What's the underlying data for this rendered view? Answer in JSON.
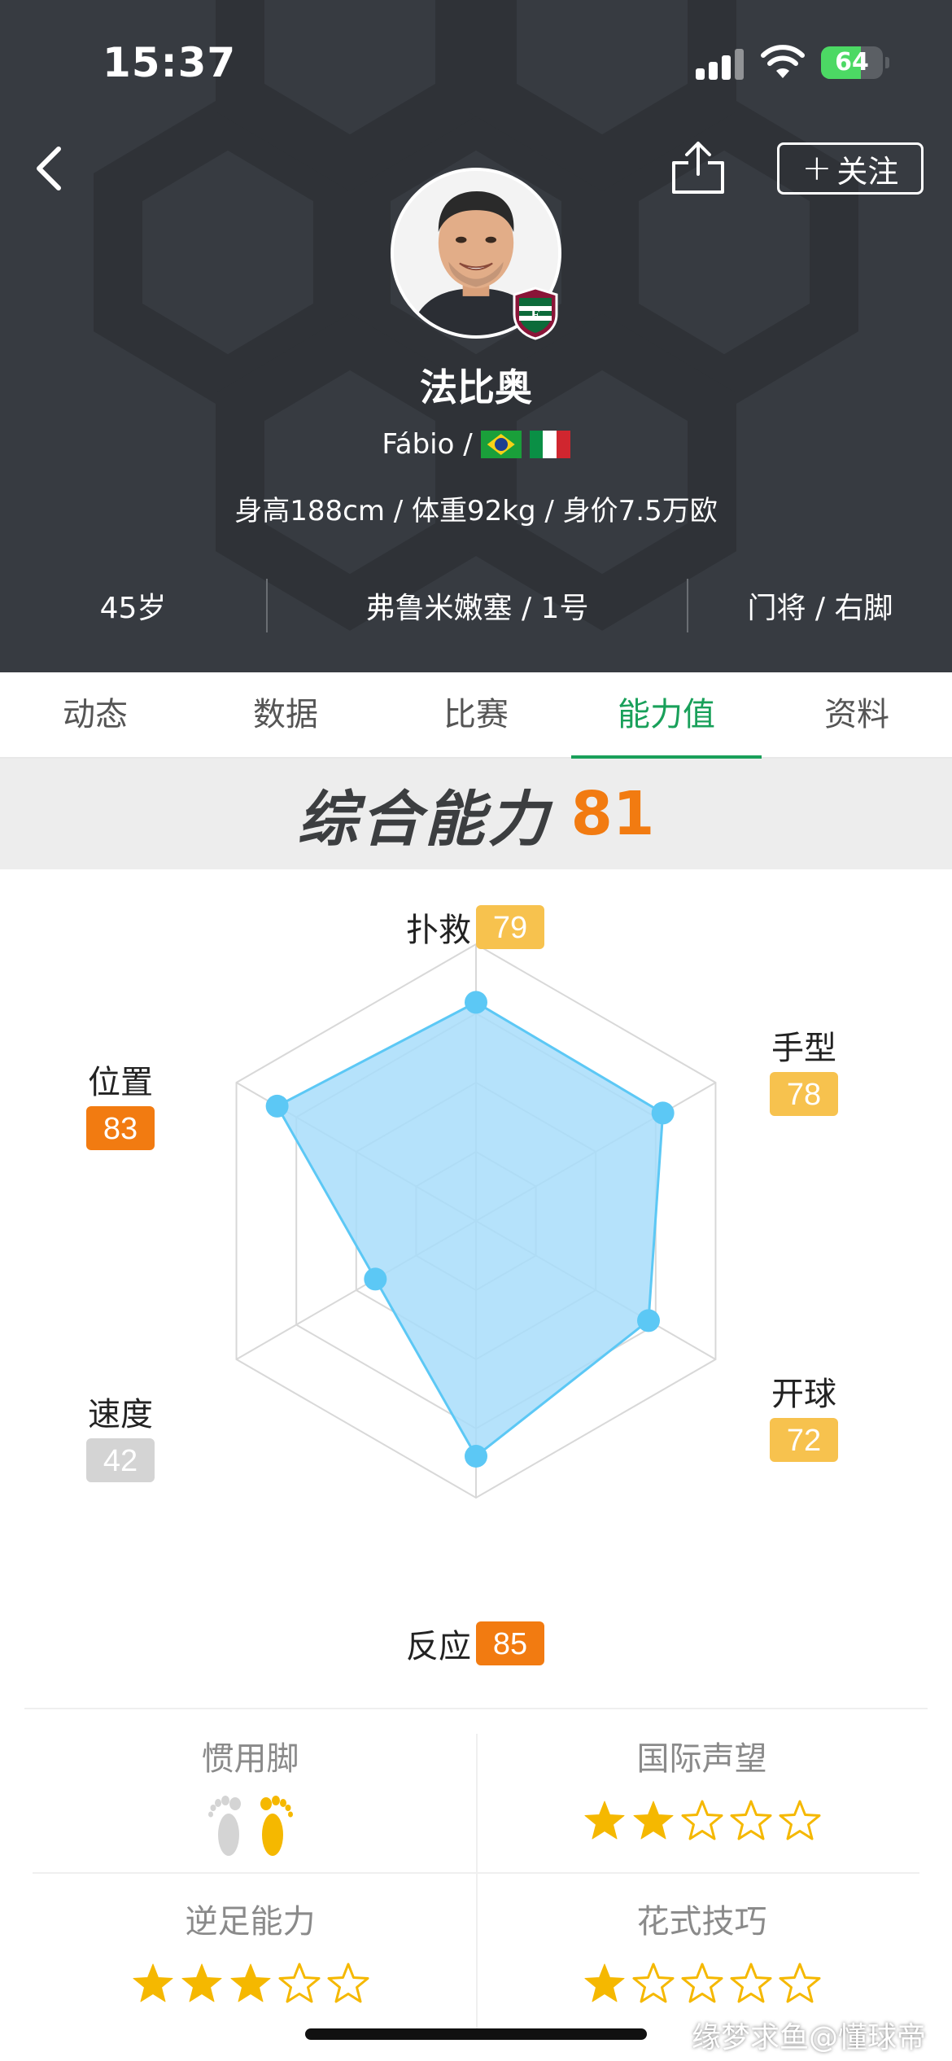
{
  "status": {
    "time": "15:37",
    "battery": "64",
    "battery_level": 0.64
  },
  "header": {
    "follow_label": "关注",
    "player_name": "法比奥",
    "name_latin": "Fábio /",
    "info": "身高188cm / 体重92kg / 身价7.5万欧",
    "stats": [
      "45岁",
      "弗鲁米嫩塞 / 1号",
      "门将 / 右脚"
    ],
    "flags": [
      "brazil-flag",
      "italy-flag"
    ]
  },
  "tabs": [
    {
      "label": "动态",
      "active": false
    },
    {
      "label": "数据",
      "active": false
    },
    {
      "label": "比赛",
      "active": false
    },
    {
      "label": "能力值",
      "active": true
    },
    {
      "label": "资料",
      "active": false
    }
  ],
  "overall": {
    "label": "综合能力",
    "value": "81"
  },
  "chart_data": {
    "type": "radar",
    "max": 100,
    "axes": [
      {
        "label": "扑救",
        "value": 79
      },
      {
        "label": "手型",
        "value": 78
      },
      {
        "label": "开球",
        "value": 72
      },
      {
        "label": "反应",
        "value": 85
      },
      {
        "label": "速度",
        "value": 42
      },
      {
        "label": "位置",
        "value": 83
      }
    ]
  },
  "attributes": {
    "foot": {
      "label": "惯用脚",
      "preferred": "right"
    },
    "reputation": {
      "label": "国际声望",
      "stars": 2,
      "max": 5
    },
    "weak_foot": {
      "label": "逆足能力",
      "stars": 3,
      "max": 5
    },
    "skill_moves": {
      "label": "花式技巧",
      "stars": 1,
      "max": 5
    }
  },
  "watermark": "缘梦求鱼@懂球帝",
  "colors": {
    "header_bg": "#373b41",
    "accent_green": "#19a05a",
    "orange": "#f27b11",
    "badge_high": "#f27b11",
    "badge_mid": "#f7c24e",
    "badge_low": "#d4d4d4",
    "radar_fill": "#a8ddfa",
    "radar_stroke": "#5cc8f5",
    "star": "#f5b800"
  }
}
